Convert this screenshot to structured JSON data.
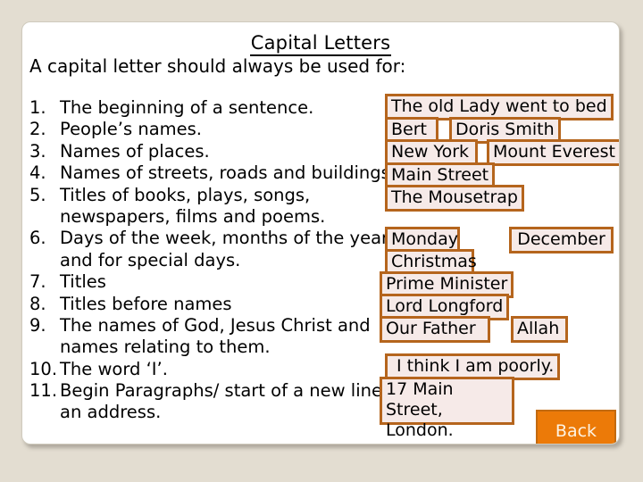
{
  "slide": {
    "title": "Capital Letters",
    "lead": "A  capital letter should always be used for:",
    "back_label": "Back",
    "colors": {
      "page_background": "#e3ddd1",
      "slide_background": "#ffffff",
      "box_border": "#b5651d",
      "box_fill": "#f6eae8",
      "button_fill": "#ec7a08",
      "button_border": "#c26a10",
      "button_text": "#fdf3e3",
      "text": "#000000"
    },
    "rules": [
      {
        "num": "1.",
        "text": "The beginning of a sentence."
      },
      {
        "num": "2.",
        "text": "People’s names."
      },
      {
        "num": "3.",
        "text": "Names of places."
      },
      {
        "num": "4.",
        "text": "Names of  streets, roads and buildings."
      },
      {
        "num": "5.",
        "text": "Titles of books, plays, songs,"
      },
      {
        "num": "",
        "text": "newspapers, films and poems."
      },
      {
        "num": "6.",
        "text": "Days of the week, months of the year"
      },
      {
        "num": "",
        "text": "and for special days."
      },
      {
        "num": "7.",
        "text": "Titles"
      },
      {
        "num": "8.",
        "text": "Titles before names"
      },
      {
        "num": "9.",
        "text": "The names of God, Jesus Christ and"
      },
      {
        "num": "",
        "text": "names relating to them."
      },
      {
        "num": "10.",
        "text": "The word ‘I’."
      },
      {
        "num": "11.",
        "text": "Begin Paragraphs/ start of a new line of"
      },
      {
        "num": "",
        "text": "an address."
      }
    ],
    "examples": [
      {
        "text": "The old Lady went to bed"
      },
      {
        "text": "Bert"
      },
      {
        "text": "Doris Smith"
      },
      {
        "text": "New York"
      },
      {
        "text": "Mount Everest"
      },
      {
        "text": "Main Street"
      },
      {
        "text": "The Mousetrap"
      },
      {
        "text": "Monday"
      },
      {
        "text": "December"
      },
      {
        "text": "Christmas"
      },
      {
        "text": "Prime Minister"
      },
      {
        "text": "Lord Longford"
      },
      {
        "text": "Our Father"
      },
      {
        "text": "Allah"
      },
      {
        "text": "I think I am poorly."
      },
      {
        "text": "17 Main Street,\nLondon."
      }
    ]
  }
}
